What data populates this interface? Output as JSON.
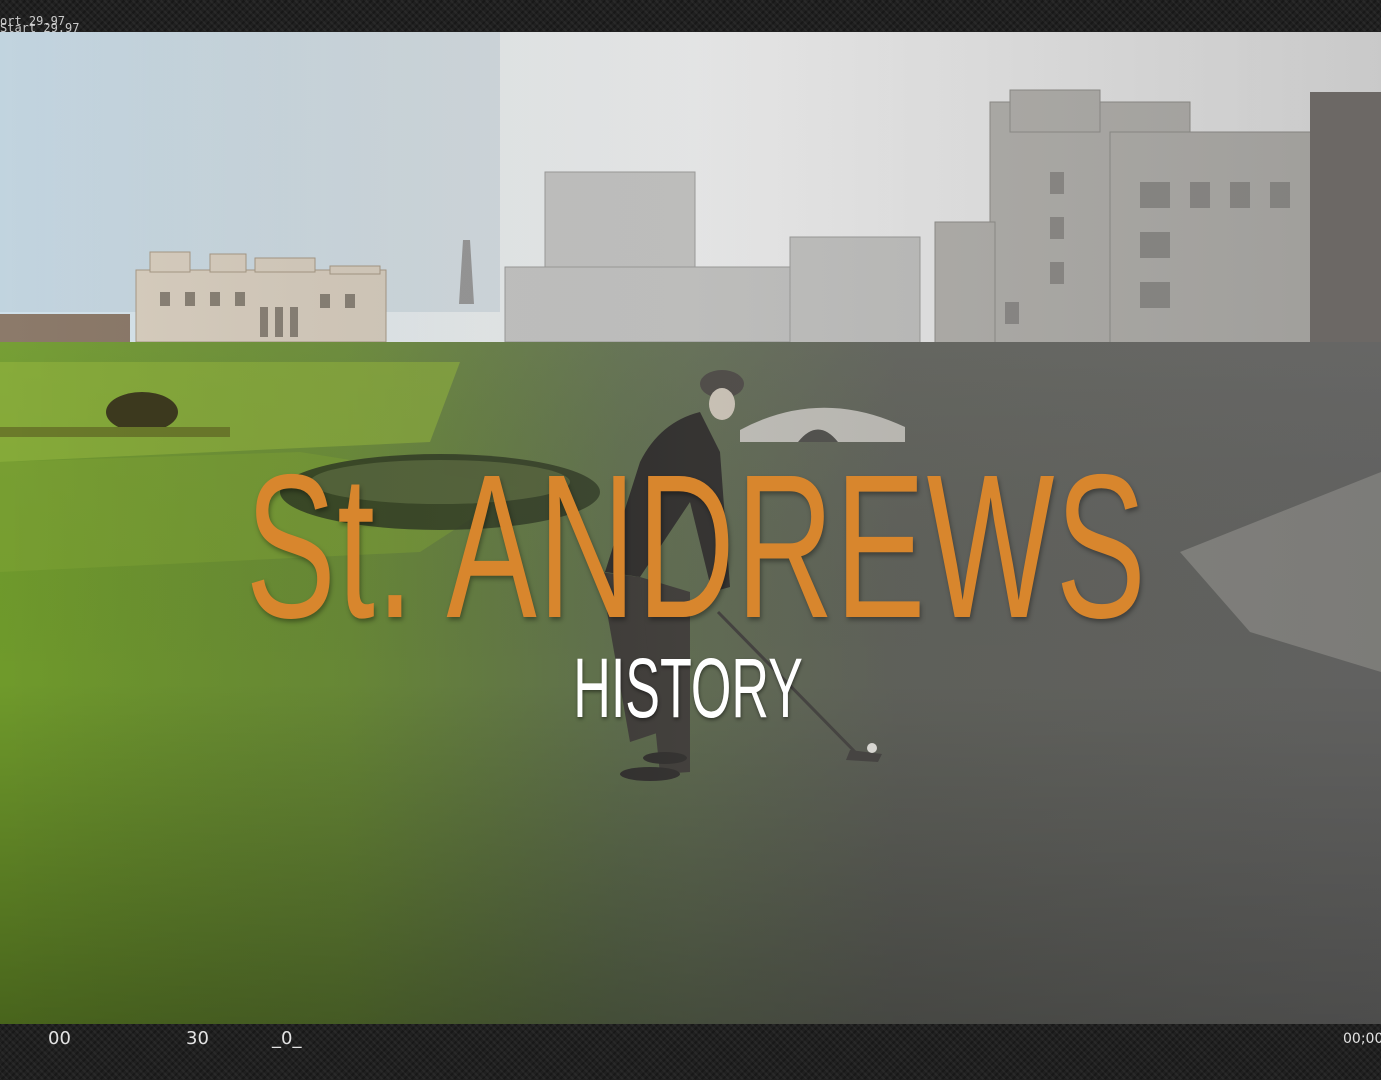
{
  "title": "St. ANDREWS",
  "subtitle": "HISTORY",
  "timecode": {
    "top_line_1": "ort 29.97",
    "top_line_2": "Start 29.97",
    "bottom": [
      "00",
      "30",
      "_0_",
      "00;00"
    ]
  },
  "colors": {
    "title": "#d8862d",
    "subtitle": "#ffffff",
    "frame_band": "#202020"
  }
}
